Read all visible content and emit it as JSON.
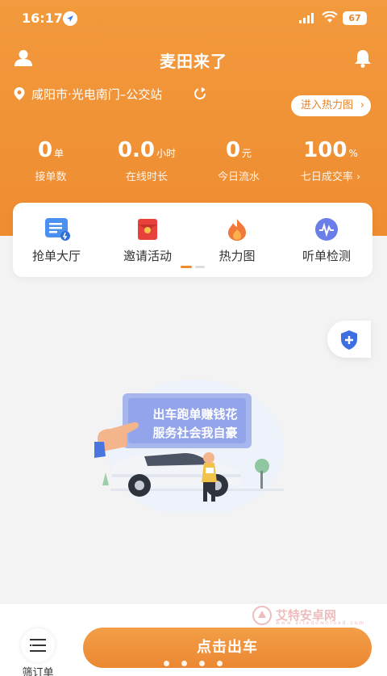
{
  "status_bar": {
    "time": "16:17",
    "battery": "67"
  },
  "header": {
    "title": "麦田来了",
    "location": "咸阳市·光电南门–公交站",
    "heatmap_button": "进入热力图"
  },
  "stats": [
    {
      "value": "0",
      "unit": "单",
      "label": "接单数"
    },
    {
      "value": "0.0",
      "unit": "小时",
      "label": "在线时长"
    },
    {
      "value": "0",
      "unit": "元",
      "label": "今日流水"
    },
    {
      "value": "100",
      "unit": "%",
      "label": "七日成交率 ›"
    }
  ],
  "functions": [
    {
      "label": "抢单大厅",
      "icon": "order-hall-icon"
    },
    {
      "label": "邀请活动",
      "icon": "red-envelope-icon"
    },
    {
      "label": "热力图",
      "icon": "flame-icon"
    },
    {
      "label": "听单检测",
      "icon": "wave-icon"
    }
  ],
  "illustration": {
    "line1": "出车跑单赚钱花",
    "line2": "服务社会我自豪"
  },
  "bottom": {
    "filter_label": "筛订单",
    "depart_button": "点击出车"
  },
  "watermark": {
    "name": "艾特安卓网",
    "url": "www.aitedownload.com"
  },
  "colors": {
    "brand_orange": "#ef8c31",
    "accent_blue": "#3d6fe0"
  }
}
